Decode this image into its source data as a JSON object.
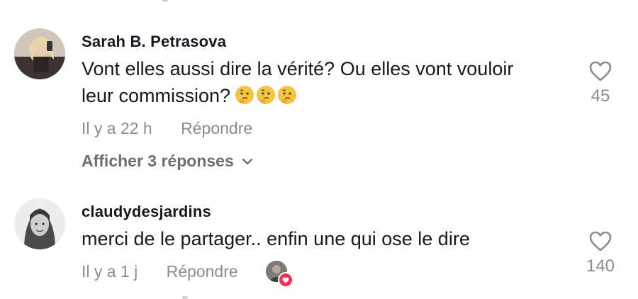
{
  "comments": [
    {
      "username": "Sarah B. Petrasova",
      "text_line1": "Vont elles aussi dire la vérité? Ou elles vont vouloir",
      "text_line2": "leur commission?",
      "emojis": [
        "thinking-face",
        "thinking-face",
        "thinking-face"
      ],
      "time": "Il y a 22 h",
      "reply_label": "Répondre",
      "likes": "45",
      "view_replies": "Afficher 3 réponses",
      "avatar": "woman-photo-avatar"
    },
    {
      "username": "claudydesjardins",
      "text_line1": "merci de le partager.. enfin une qui ose le dire",
      "time": "Il y a 1 j",
      "reply_label": "Répondre",
      "likes": "140",
      "creator_liked": true,
      "avatar": "woman-photo-avatar"
    }
  ],
  "colors": {
    "text": "#161823",
    "secondary": "#8a8b91",
    "accent_heart": "#fe2c55",
    "emoji": "#f4c542"
  },
  "icons": {
    "like": "heart-outline-icon",
    "expand": "chevron-down-icon",
    "creator_like": "heart-badge-icon"
  }
}
